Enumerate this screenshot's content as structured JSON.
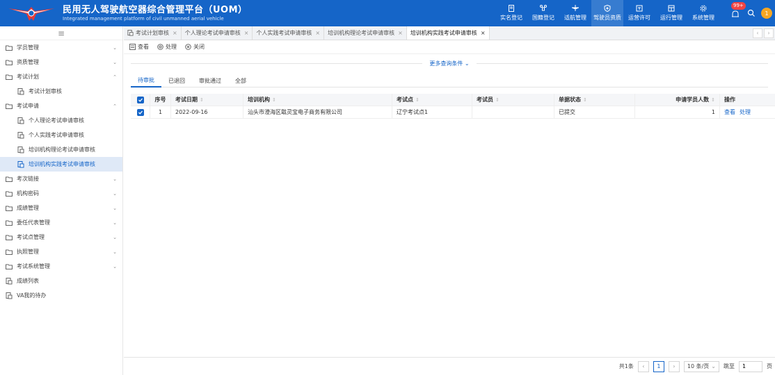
{
  "header": {
    "title": "民用无人驾驶航空器综合管理平台（UOM）",
    "subtitle": "Integrated management platform of civil unmanned aerial vehicle",
    "nav": [
      {
        "label": "实名登记",
        "icon": "doc-icon"
      },
      {
        "label": "国籍登记",
        "icon": "drone-icon"
      },
      {
        "label": "适航管理",
        "icon": "plane-icon"
      },
      {
        "label": "驾驶员资质",
        "icon": "shield-icon"
      },
      {
        "label": "运营许可",
        "icon": "license-icon"
      },
      {
        "label": "运行管理",
        "icon": "ops-icon"
      },
      {
        "label": "系统管理",
        "icon": "settings-icon"
      }
    ],
    "active_nav": 3,
    "badge": "99+",
    "avatar": "1"
  },
  "sidebar": {
    "items": [
      {
        "label": "学员管理",
        "level": 0,
        "arrow": "v",
        "selected": false
      },
      {
        "label": "资质管理",
        "level": 0,
        "arrow": "v",
        "selected": false
      },
      {
        "label": "考试计划",
        "level": 0,
        "arrow": "^",
        "selected": false
      },
      {
        "label": "考试计划审核",
        "level": 1,
        "arrow": "",
        "selected": false
      },
      {
        "label": "考试申请",
        "level": 0,
        "arrow": "^",
        "selected": false
      },
      {
        "label": "个人理论考试申请审核",
        "level": 1,
        "arrow": "",
        "selected": false
      },
      {
        "label": "个人实践考试申请审核",
        "level": 1,
        "arrow": "",
        "selected": false
      },
      {
        "label": "培训机构理论考试申请审核",
        "level": 1,
        "arrow": "",
        "selected": false
      },
      {
        "label": "培训机构实践考试申请审核",
        "level": 1,
        "arrow": "",
        "selected": true
      },
      {
        "label": "考次链接",
        "level": 0,
        "arrow": "v",
        "selected": false
      },
      {
        "label": "机构密码",
        "level": 0,
        "arrow": "v",
        "selected": false
      },
      {
        "label": "成绩管理",
        "level": 0,
        "arrow": "v",
        "selected": false
      },
      {
        "label": "委任代表管理",
        "level": 0,
        "arrow": "v",
        "selected": false
      },
      {
        "label": "考试点管理",
        "level": 0,
        "arrow": "v",
        "selected": false
      },
      {
        "label": "执照管理",
        "level": 0,
        "arrow": "v",
        "selected": false
      },
      {
        "label": "考试系统管理",
        "level": 0,
        "arrow": "v",
        "selected": false
      },
      {
        "label": "成绩列表",
        "level": 2,
        "arrow": "",
        "selected": false
      },
      {
        "label": "VA我的待办",
        "level": 2,
        "arrow": "",
        "selected": false
      }
    ]
  },
  "tabs": [
    {
      "label": "考试计划审核",
      "active": false
    },
    {
      "label": "个人理论考试申请审核",
      "active": false
    },
    {
      "label": "个人实践考试申请审核",
      "active": false
    },
    {
      "label": "培训机构理论考试申请审核",
      "active": false
    },
    {
      "label": "培训机构实践考试申请审核",
      "active": true
    }
  ],
  "toolbar": {
    "view": "查看",
    "process": "处理",
    "close": "关闭"
  },
  "more_query": "更多查询条件",
  "subtabs": [
    "待审批",
    "已退回",
    "审批通过",
    "全部"
  ],
  "table": {
    "headers": {
      "index": "序号",
      "date": "考试日期",
      "org": "培训机构",
      "site": "考试点",
      "examiner": "考试员",
      "status": "单据状态",
      "count": "申请学员人数",
      "ops": "操作"
    },
    "rows": [
      {
        "index": "1",
        "date": "2022-09-16",
        "org": "汕头市澄海区戢灵宝电子商务有限公司",
        "site": "辽宁考试点1",
        "examiner": "",
        "status": "已提交",
        "count": "1",
        "op_view": "查看",
        "op_process": "处理"
      }
    ]
  },
  "pagination": {
    "total": "共1条",
    "current": "1",
    "page_size": "10 条/页",
    "goto": "跳至",
    "goto_value": "1",
    "page_unit": "页"
  }
}
